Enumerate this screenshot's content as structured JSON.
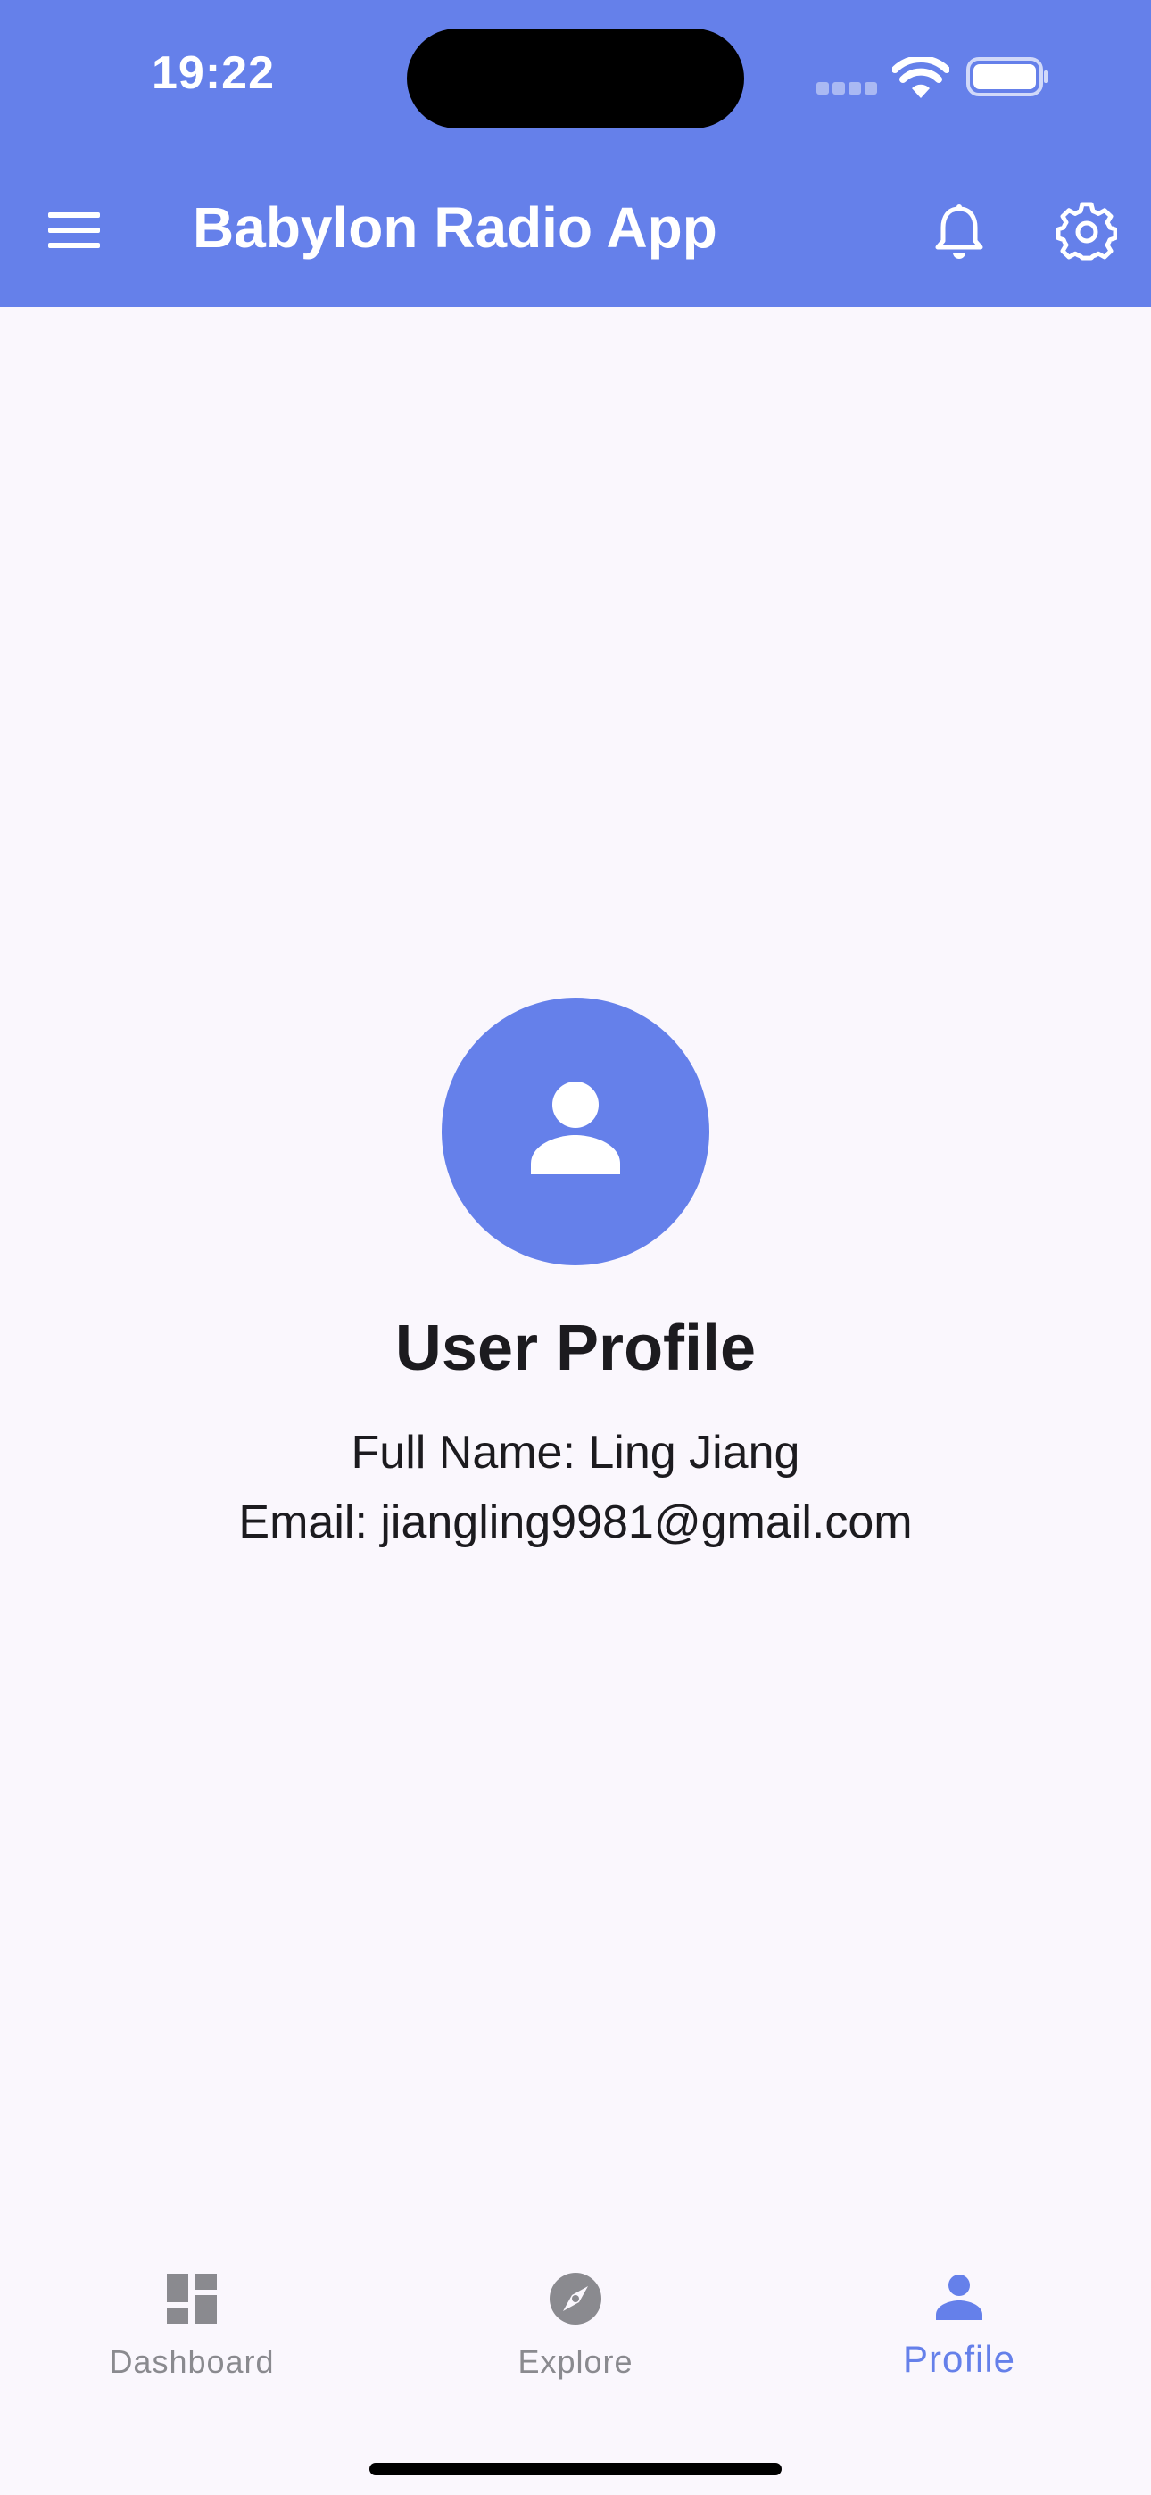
{
  "status_bar": {
    "time": "19:22"
  },
  "app_bar": {
    "title": "Babylon Radio App",
    "icons": [
      "menu-icon",
      "bell-icon",
      "gear-icon"
    ]
  },
  "profile": {
    "avatar_icon": "person-icon",
    "title": "User Profile",
    "full_name_line": "Full Name: Ling Jiang",
    "email_line": "Email: jiangling9981@gmail.com"
  },
  "bottom_nav": {
    "items": [
      {
        "label": "Dashboard",
        "icon": "dashboard-icon",
        "active": false
      },
      {
        "label": "Explore",
        "icon": "compass-icon",
        "active": false
      },
      {
        "label": "Profile",
        "icon": "person-icon",
        "active": true
      }
    ]
  },
  "colors": {
    "primary": "#6580ea",
    "background": "#faf7fd",
    "text": "#1c1b1f",
    "inactive_nav": "#8a8a8f"
  }
}
